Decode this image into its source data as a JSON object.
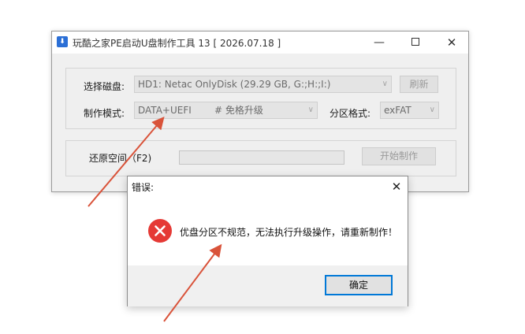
{
  "main_window": {
    "title": "玩酷之家PE启动U盘制作工具 13  [ 2026.07.18 ]",
    "icon": "app-usb-icon",
    "caption": {
      "minimize": "—",
      "close": "✕"
    },
    "disk": {
      "label": "选择磁盘:",
      "value": "HD1: Netac OnlyDisk (29.29 GB, G:;H:;I:)",
      "refresh_label": "刷新"
    },
    "mode": {
      "label": "制作模式:",
      "value": "DATA+UEFI",
      "option_note": "# 免格升级"
    },
    "partition": {
      "label": "分区格式:",
      "value": "exFAT"
    },
    "restore": {
      "label": "还原空间（F2)",
      "start_label": "开始制作"
    }
  },
  "error_dialog": {
    "title": "错误:",
    "icon": "error-x-icon",
    "message": "优盘分区不规范，无法执行升级操作，请重新制作！",
    "ok_label": "确定",
    "close_glyph": "✕"
  },
  "colors": {
    "error_red": "#e53935",
    "annotation_arrow": "#d9533a",
    "focus_blue": "#0078d7"
  }
}
